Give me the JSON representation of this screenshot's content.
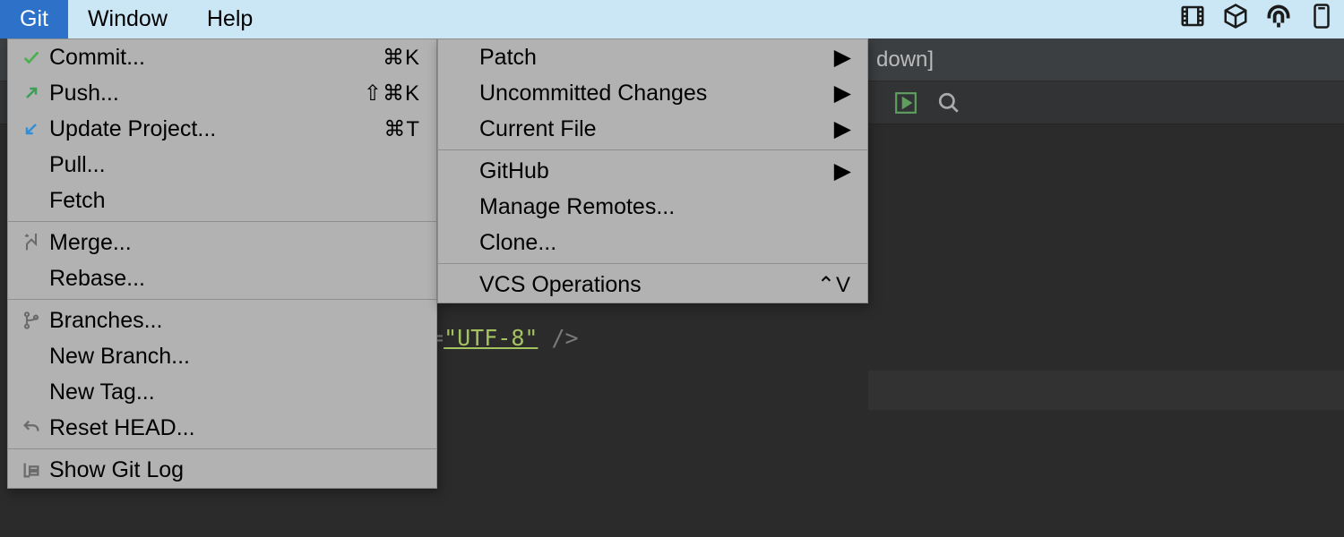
{
  "menubar": {
    "items": [
      {
        "label": "Git",
        "active": true
      },
      {
        "label": "Window",
        "active": false
      },
      {
        "label": "Help",
        "active": false
      }
    ],
    "right_icons": [
      "film-icon",
      "cube-icon",
      "fingerprint-icon",
      "device-icon"
    ]
  },
  "git_menu": {
    "items": [
      {
        "icon": "check-icon",
        "label": "Commit...",
        "shortcut": "⌘K"
      },
      {
        "icon": "arrow-up-right-icon",
        "label": "Push...",
        "shortcut": "⇧⌘K"
      },
      {
        "icon": "arrow-down-left-icon",
        "label": "Update Project...",
        "shortcut": "⌘T"
      },
      {
        "icon": "",
        "label": "Pull...",
        "shortcut": ""
      },
      {
        "icon": "",
        "label": "Fetch",
        "shortcut": ""
      },
      {
        "sep": true
      },
      {
        "icon": "merge-icon",
        "label": "Merge...",
        "shortcut": ""
      },
      {
        "icon": "",
        "label": "Rebase...",
        "shortcut": ""
      },
      {
        "sep": true
      },
      {
        "icon": "branch-icon",
        "label": "Branches...",
        "shortcut": ""
      },
      {
        "icon": "",
        "label": "New Branch...",
        "shortcut": ""
      },
      {
        "icon": "",
        "label": "New Tag...",
        "shortcut": ""
      },
      {
        "icon": "undo-icon",
        "label": "Reset HEAD...",
        "shortcut": ""
      },
      {
        "sep": true
      },
      {
        "icon": "log-icon",
        "label": "Show Git Log",
        "shortcut": ""
      }
    ]
  },
  "sub_menu": {
    "items": [
      {
        "label": "Patch",
        "submenu": true
      },
      {
        "label": "Uncommitted Changes",
        "submenu": true
      },
      {
        "label": "Current File",
        "submenu": true
      },
      {
        "sep": true
      },
      {
        "label": "GitHub",
        "submenu": true
      },
      {
        "label": "Manage Remotes...",
        "submenu": false
      },
      {
        "label": "Clone...",
        "submenu": false
      },
      {
        "sep": true
      },
      {
        "label": "VCS Operations",
        "submenu": false,
        "shortcut": "⌃V"
      }
    ]
  },
  "editor": {
    "tab_fragment": "down]",
    "code_prefix": "=",
    "code_value": "\"UTF-8\"",
    "code_suffix": " />"
  }
}
